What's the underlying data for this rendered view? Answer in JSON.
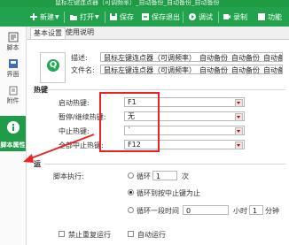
{
  "title_bar": {
    "text": "鼠标左键连点器（可调频率）_自动备份_自动备份_自动备份"
  },
  "toolbar": {
    "new_label": "新建",
    "open_label": "打开",
    "save_label": "保存",
    "save_exit_label": "保存退出",
    "debug_label": "调试",
    "record_label": "录制",
    "more_label": "功能"
  },
  "sidebar": {
    "items": [
      {
        "label": "脚本",
        "icon": "script-icon"
      },
      {
        "label": "界面",
        "icon": "ui-icon"
      },
      {
        "label": "附件",
        "icon": "attachment-icon"
      },
      {
        "label": "脚本属性",
        "icon": "info-icon"
      }
    ]
  },
  "tabs": [
    {
      "label": "基本设置"
    },
    {
      "label": "使用说明"
    }
  ],
  "basic": {
    "desc_label": "描述:",
    "desc_value": "鼠标左键连点器（可调频率）_自动备份_自动备份_自动备份_",
    "file_label": "文件名:",
    "file_value": "鼠标左键连点器（可调频率）_自动备份_自动备份_自动备份.Q",
    "icon_letter": "Q"
  },
  "hotkeys": {
    "section_label": "热键",
    "start_label": "启动热键:",
    "start_value": "F1",
    "pause_label": "暂停/继续热键:",
    "pause_value": "无",
    "stop_label": "中止热键:",
    "stop_value": "`",
    "stop_all_label": "全部中止热键:",
    "stop_all_value": "F12"
  },
  "run": {
    "section_label": "运",
    "mode_label": "脚本执行:",
    "loop_label": "循环",
    "loop_count": "1",
    "loop_unit": "次",
    "until_stop_label": "循环到按中止键为止",
    "loop_time_label": "循环一段时间",
    "hours_value": "0",
    "hours_unit": "小时",
    "minutes_value": "1",
    "minutes_unit": "分钟"
  },
  "options": {
    "no_repeat_label": "禁止重复运行",
    "auto_run_label": "自动运行"
  },
  "colors": {
    "toolbar_green": "#22a24c",
    "sidebar_active": "#1e9c47",
    "highlight_red": "#e22222"
  }
}
